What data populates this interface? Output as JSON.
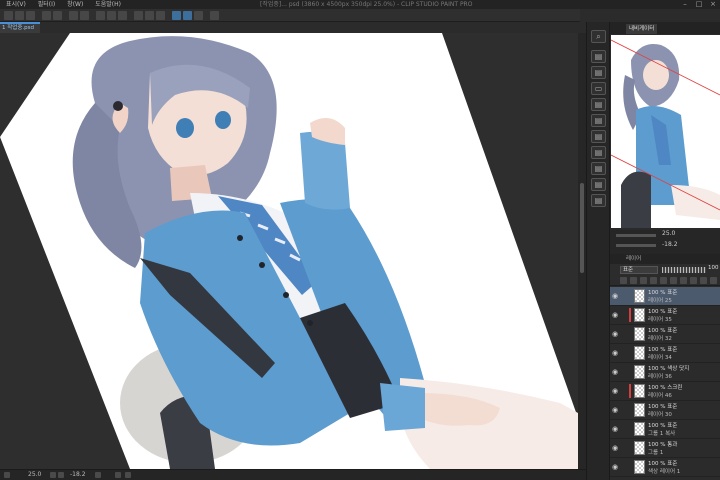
{
  "title_bar": {
    "menu": [
      "표시(V)",
      "필터(I)",
      "창(W)",
      "도움말(H)"
    ],
    "window_title": "[작업중]... psd (3860 x 4500px 350dpi 25.0%) - CLIP STUDIO PAINT PRO"
  },
  "document_tab": {
    "label": "1 작업중.psd"
  },
  "status_bar": {
    "zoom": "25.0",
    "angle": "-18.2"
  },
  "navigator": {
    "tab_label": "내비게이터",
    "zoom": "25.0",
    "angle": "-18.2"
  },
  "layer_panel": {
    "tab_label": "레이어",
    "blend_mode": "표준",
    "opacity": "100",
    "layers": [
      {
        "line1": "100 % 표준",
        "line2": "레이어 25",
        "selected": true,
        "color_tag": false
      },
      {
        "line1": "100 % 표준",
        "line2": "레이어 35",
        "selected": false,
        "color_tag": true
      },
      {
        "line1": "100 % 표준",
        "line2": "레이어 32",
        "selected": false,
        "color_tag": false
      },
      {
        "line1": "100 % 표준",
        "line2": "레이어 34",
        "selected": false,
        "color_tag": false
      },
      {
        "line1": "100 % 색상 닷지",
        "line2": "레이어 36",
        "selected": false,
        "color_tag": false
      },
      {
        "line1": "100 % 스크린",
        "line2": "레이어 46",
        "selected": false,
        "color_tag": true
      },
      {
        "line1": "100 % 표준",
        "line2": "레이어 30",
        "selected": false,
        "color_tag": false
      },
      {
        "line1": "100 % 표준",
        "line2": "그룹 1 복사",
        "selected": false,
        "color_tag": false
      },
      {
        "line1": "100 % 통과",
        "line2": "그룹 1",
        "selected": false,
        "color_tag": false
      },
      {
        "line1": "100 % 표준",
        "line2": "색상 레이어 1",
        "selected": false,
        "color_tag": false
      }
    ]
  },
  "colors": {
    "accent": "#4a90d9",
    "cardigan": "#5d9ccf",
    "hair": "#8b93b0",
    "selected_layer": "#4c5a6e"
  }
}
